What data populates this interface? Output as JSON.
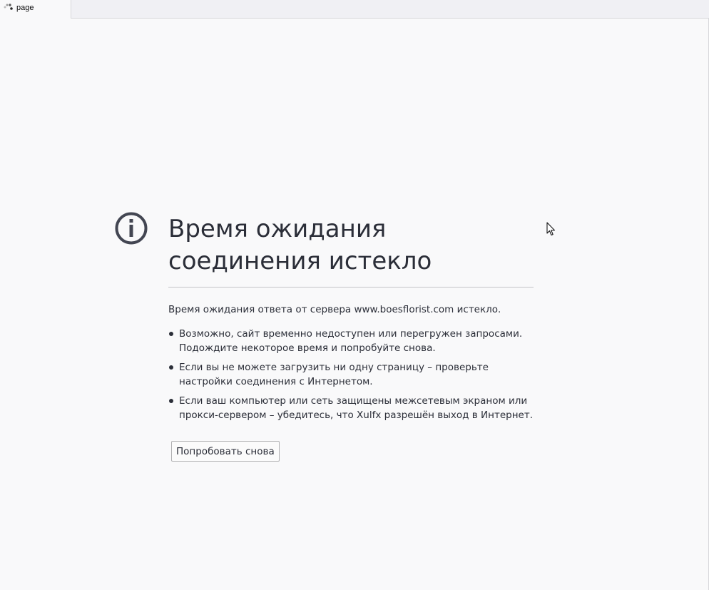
{
  "tab": {
    "label": "page",
    "icon": "loading-spinner-icon"
  },
  "error": {
    "icon": "info-icon",
    "title": "Время ожидания соединения истекло",
    "description": "Время ожидания ответа от сервера www.boesflorist.com истекло.",
    "tips": [
      {
        "line1": "Возможно, сайт временно недоступен или перегружен запросами.",
        "line2": "Подождите некоторое время и попробуйте снова."
      },
      {
        "line1": "Если вы не можете загрузить ни одну страницу – проверьте",
        "line2": "настройки соединения с Интернетом."
      },
      {
        "line1": "Если ваш компьютер или сеть защищены межсетевым экраном или",
        "line2": "прокси-сервером – убедитесь, что Xulfx разрешён выход в Интернет."
      }
    ],
    "retry_label": "Попробовать снова"
  },
  "colors": {
    "background": "#f9f9fa",
    "text": "#2b2e38",
    "icon": "#434652"
  }
}
